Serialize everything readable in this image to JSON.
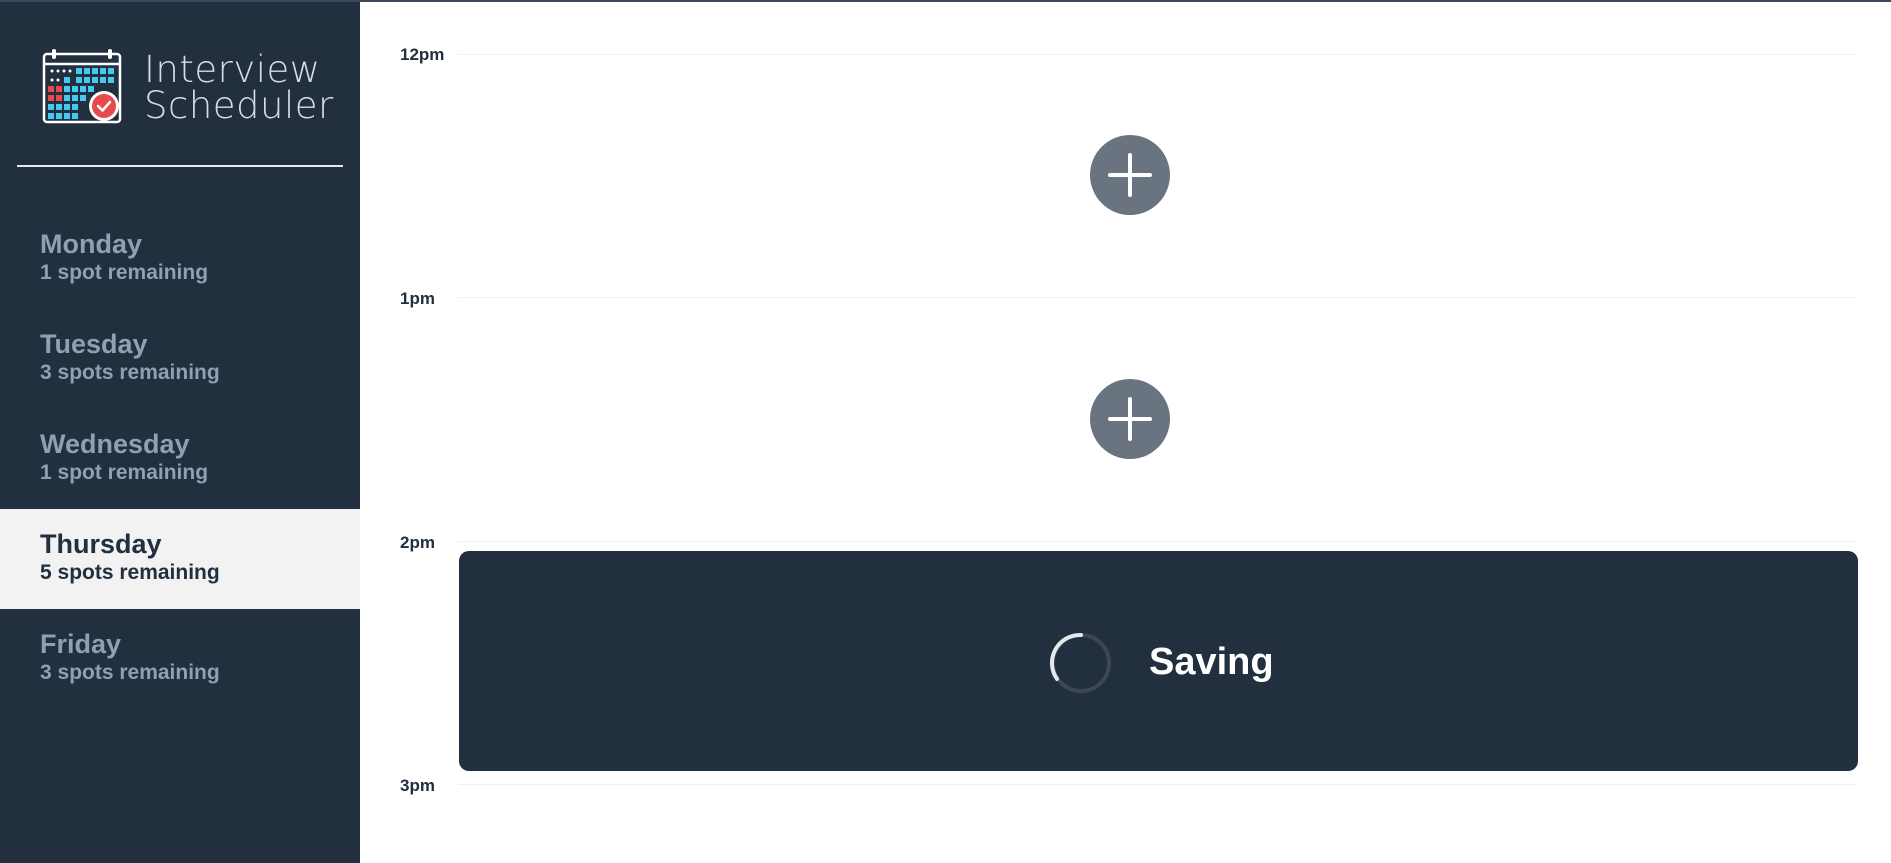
{
  "app": {
    "title_line1": "Interview",
    "title_line2": "Scheduler",
    "logo_icon": "calendar-check-icon"
  },
  "sidebar": {
    "days": [
      {
        "name": "Monday",
        "spots": "1 spot remaining",
        "selected": false
      },
      {
        "name": "Tuesday",
        "spots": "3 spots remaining",
        "selected": false
      },
      {
        "name": "Wednesday",
        "spots": "1 spot remaining",
        "selected": false
      },
      {
        "name": "Thursday",
        "spots": "5 spots remaining",
        "selected": true
      },
      {
        "name": "Friday",
        "spots": "3 spots remaining",
        "selected": false
      }
    ]
  },
  "schedule": {
    "times": [
      "12pm",
      "1pm",
      "2pm",
      "3pm"
    ],
    "slots": [
      {
        "state": "empty",
        "icon": "plus-icon"
      },
      {
        "state": "empty",
        "icon": "plus-icon"
      },
      {
        "state": "saving",
        "icon": "spinner-icon",
        "status_text": "Saving"
      }
    ]
  },
  "colors": {
    "sidebar_bg": "#222f3e",
    "selected_bg": "#f2f2f2",
    "muted_text": "#8ea0b2",
    "add_button": "#6a7380",
    "card_bg": "#222f3e",
    "logo_red": "#e8494c",
    "logo_blue": "#45c9ee"
  }
}
